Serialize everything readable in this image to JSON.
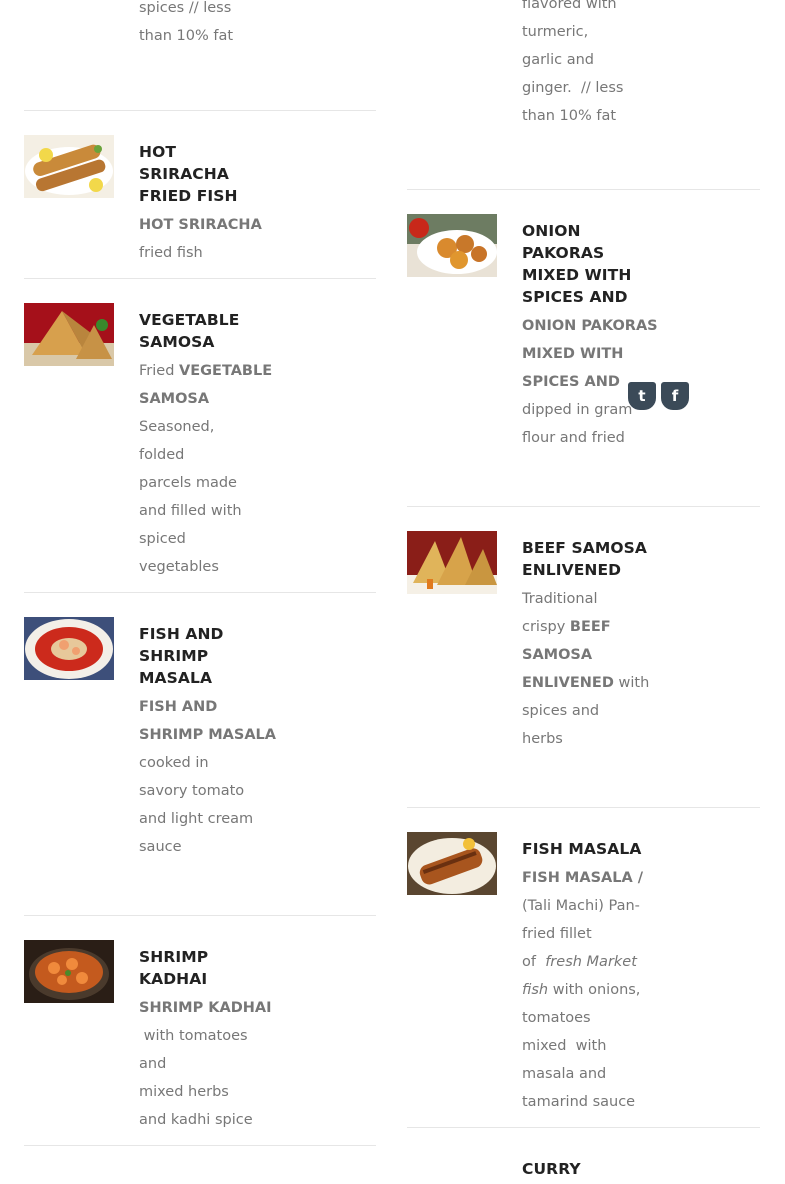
{
  "left": {
    "partial_item": {
      "desc": [
        "spices  // less",
        "than 10% fat"
      ]
    },
    "items": [
      {
        "title": [
          "HOT",
          "SRIRACHA",
          "FRIED FISH"
        ],
        "desc_bold": "HOT SRIRACHA",
        "desc": [
          "fried fish"
        ]
      },
      {
        "title": [
          "VEGETABLE",
          "SAMOSA"
        ],
        "desc_prefix": "Fried",
        "desc_bold_1": "VEGETABLE",
        "desc_bold_2": "SAMOSA",
        "desc": [
          "Seasoned,",
          "folded",
          "parcels made",
          "and filled with",
          "spiced",
          "vegetables"
        ]
      },
      {
        "title": [
          "FISH AND",
          "SHRIMP",
          "MASALA"
        ],
        "desc_bold_1": "FISH AND",
        "desc_bold_2": "SHRIMP MASALA",
        "desc": [
          "cooked in",
          "savory tomato",
          "and light cream",
          "sauce"
        ]
      },
      {
        "title": [
          "SHRIMP",
          "KADHAI"
        ],
        "desc_bold": "SHRIMP KADHAI",
        "desc": [
          " with tomatoes",
          "and",
          "mixed herbs",
          "and kadhi spice"
        ]
      }
    ]
  },
  "right": {
    "partial_item": {
      "desc": [
        "flavored with",
        "turmeric,",
        "garlic and",
        "ginger.  // less",
        "than 10% fat"
      ]
    },
    "items": [
      {
        "title": [
          "ONION",
          "PAKORAS",
          "MIXED WITH",
          "SPICES AND"
        ],
        "desc_bold": [
          "ONION PAKORAS",
          "MIXED WITH",
          "SPICES AND"
        ],
        "desc": [
          "dipped in gram",
          "flour and fried"
        ]
      },
      {
        "title": [
          "BEEF SAMOSA",
          "ENLIVENED"
        ],
        "desc_l1": "Traditional",
        "desc_l2_prefix": "crispy",
        "desc_bold_1": "BEEF",
        "desc_bold_2": "SAMOSA",
        "desc_bold_3": "ENLIVENED",
        "desc_l4_suffix": "with",
        "desc": [
          "spices and",
          "herbs"
        ]
      },
      {
        "title": [
          "FISH MASALA"
        ],
        "desc_bold_1": "FISH MASALA /",
        "desc_l2": "(Tali Machi) Pan-",
        "desc_l3": "fried fillet",
        "desc_l4_prefix": "of",
        "desc_italic_1": "fresh Market",
        "desc_italic_2": "fish",
        "desc_l5_suffix": "with onions,",
        "desc": [
          "tomatoes",
          "mixed  with",
          "masala and",
          "tamarind sauce"
        ]
      },
      {
        "title": [
          "CURRY"
        ]
      }
    ]
  },
  "share": {
    "twitter_icon": "twitter-icon",
    "facebook_icon": "facebook-icon",
    "twitter_glyph": "t",
    "facebook_glyph": "f"
  }
}
